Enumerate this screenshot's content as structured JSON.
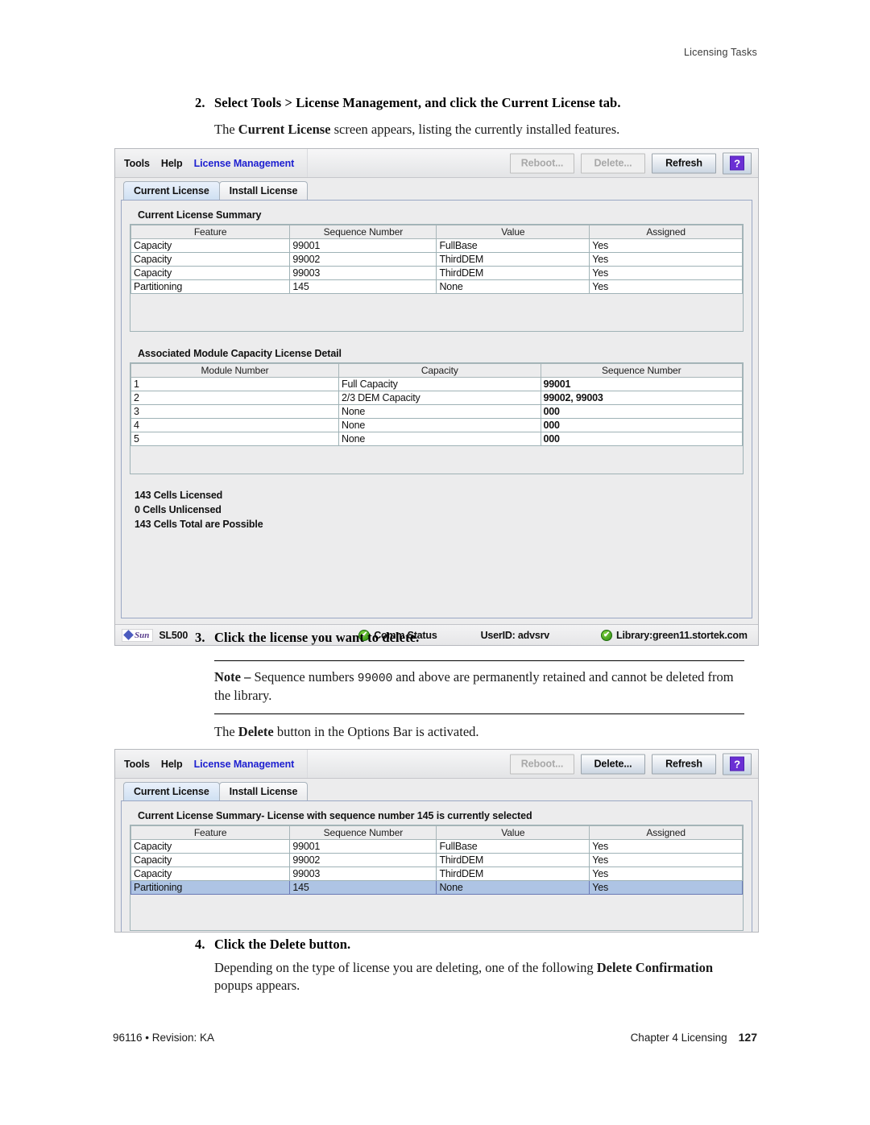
{
  "page": {
    "running_head": "Licensing Tasks",
    "footer_left": "96116 • Revision: KA",
    "footer_right": "Chapter 4 Licensing",
    "footer_page": "127"
  },
  "steps": {
    "step2_num": "2.",
    "step2_text": "Select Tools > License Management, and click the Current License tab.",
    "step2_body_a": "The ",
    "step2_body_b": "Current License",
    "step2_body_c": " screen appears, listing the currently installed features.",
    "step3_num": "3.",
    "step3_text": "Click the license you want to delete.",
    "note_label": "Note –",
    "note_text_a": " Sequence numbers ",
    "note_mono": "99000",
    "note_text_b": " and above are permanently retained and cannot be deleted from the library.",
    "after_note_a": "The ",
    "after_note_b": "Delete",
    "after_note_c": " button in the Options Bar is activated.",
    "step4_num": "4.",
    "step4_text": "Click the Delete button.",
    "step4_body_a": "Depending on the type of license you are deleting, one of the following ",
    "step4_body_b": "Delete Confirmation",
    "step4_body_c": " popups appears."
  },
  "app": {
    "menu": {
      "tools": "Tools",
      "help": "Help",
      "title": "License Management"
    },
    "toolbar": {
      "reboot": "Reboot...",
      "delete": "Delete...",
      "refresh": "Refresh",
      "help_glyph": "?"
    },
    "tabs": [
      {
        "label": "Current License",
        "active": true
      },
      {
        "label": "Install License",
        "active": false
      }
    ],
    "summary_title": "Current License Summary",
    "summary_title_selected": "Current License Summary- License with sequence number 145 is currently selected",
    "summary_columns": [
      "Feature",
      "Sequence Number",
      "Value",
      "Assigned"
    ],
    "summary_rows": [
      {
        "cells": [
          "Capacity",
          "99001",
          "FullBase",
          "Yes"
        ],
        "selected": false
      },
      {
        "cells": [
          "Capacity",
          "99002",
          "ThirdDEM",
          "Yes"
        ],
        "selected": false
      },
      {
        "cells": [
          "Capacity",
          "99003",
          "ThirdDEM",
          "Yes"
        ],
        "selected": false
      },
      {
        "cells": [
          "Partitioning",
          "145",
          "None",
          "Yes"
        ],
        "selected": false
      }
    ],
    "summary_rows_selected": [
      {
        "cells": [
          "Capacity",
          "99001",
          "FullBase",
          "Yes"
        ],
        "selected": false
      },
      {
        "cells": [
          "Capacity",
          "99002",
          "ThirdDEM",
          "Yes"
        ],
        "selected": false
      },
      {
        "cells": [
          "Capacity",
          "99003",
          "ThirdDEM",
          "Yes"
        ],
        "selected": false
      },
      {
        "cells": [
          "Partitioning",
          "145",
          "None",
          "Yes"
        ],
        "selected": true
      }
    ],
    "detail_title": "Associated Module Capacity License Detail",
    "detail_columns": [
      "Module Number",
      "Capacity",
      "Sequence Number"
    ],
    "detail_rows": [
      [
        "1",
        "Full Capacity",
        "99001"
      ],
      [
        "2",
        "2/3 DEM Capacity",
        "99002, 99003"
      ],
      [
        "3",
        "None",
        "000"
      ],
      [
        "4",
        "None",
        "000"
      ],
      [
        "5",
        "None",
        "000"
      ]
    ],
    "cells_licensed": "143 Cells Licensed",
    "cells_unlicensed": "0 Cells Unlicensed",
    "cells_total": "143 Cells Total are Possible",
    "status": {
      "product": "SL500",
      "sun_word": "Sun",
      "comm": "Comm Status",
      "user": "UserID: advsrv",
      "library": "Library:green11.stortek.com",
      "ok_glyph": "✔"
    },
    "colors": {
      "link": "#1d1fd0",
      "selection": "#aec4e4",
      "help_purple": "#6a2fd4",
      "status_green": "#2e8a14",
      "panel_bg": "#ececed"
    }
  }
}
